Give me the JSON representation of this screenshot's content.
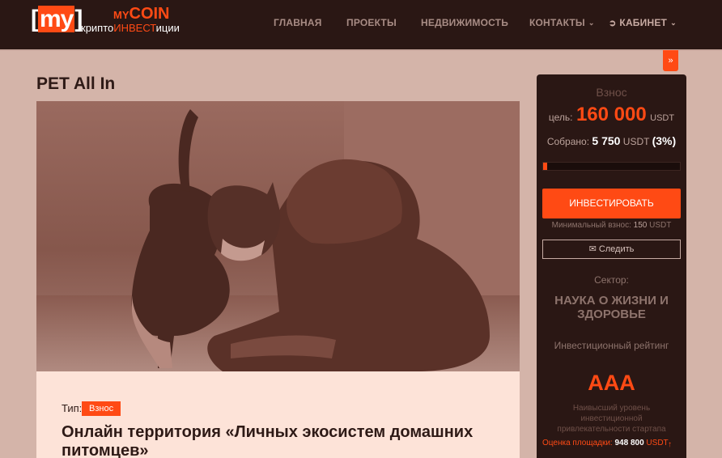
{
  "header": {
    "logo_bracket_open": "[",
    "logo_my": "my",
    "logo_bracket_close": "]",
    "logo_mycoin_small": "MY",
    "logo_mycoin_large": "COIN",
    "logo_sub_a": "крипто",
    "logo_sub_b": "ИНВЕСТ",
    "logo_sub_c": "иции",
    "nav": {
      "home": "ГЛАВНАЯ",
      "projects": "ПРОЕКТЫ",
      "realty": "НЕДВИЖИМОСТЬ",
      "contacts": "КОНТАКТЫ",
      "cabinet": "КАБИНЕТ"
    }
  },
  "page": {
    "title": "PET All In"
  },
  "card": {
    "type_label": "Тип:",
    "type_badge": "Взнос",
    "title": "Онлайн территория «Личных экосистем домашних питомцев»"
  },
  "sidebar": {
    "heading": "Взнос",
    "goal_label": "цель:",
    "goal_value": "160 000",
    "goal_currency": "USDT",
    "raised_label": "Собрано:",
    "raised_value": "5 750",
    "raised_currency": "USDT",
    "raised_percent": "(3%)",
    "progress": 0.03,
    "invest_button": "ИНВЕСТИРОВАТЬ",
    "min_label": "Минимальный взнос:",
    "min_value": "150",
    "min_currency": "USDT",
    "follow_button": "Следить",
    "sector_label": "Сектор:",
    "sector_value": "НАУКА О ЖИЗНИ И ЗДОРОВЬЕ",
    "rating_label": "Инвестиционный рейтинг",
    "rating_value": "AAA",
    "rating_desc": "Наивысший уровень инвестиционной привлекательности стартапа",
    "valuation_label": "Оценка площадки:",
    "valuation_value": "948 800",
    "valuation_currency": "USDT"
  },
  "colors": {
    "accent": "#ff4a14",
    "header_bg": "#2a1714",
    "page_bg": "#d4b4a9",
    "card_bg": "#fde3d8"
  }
}
